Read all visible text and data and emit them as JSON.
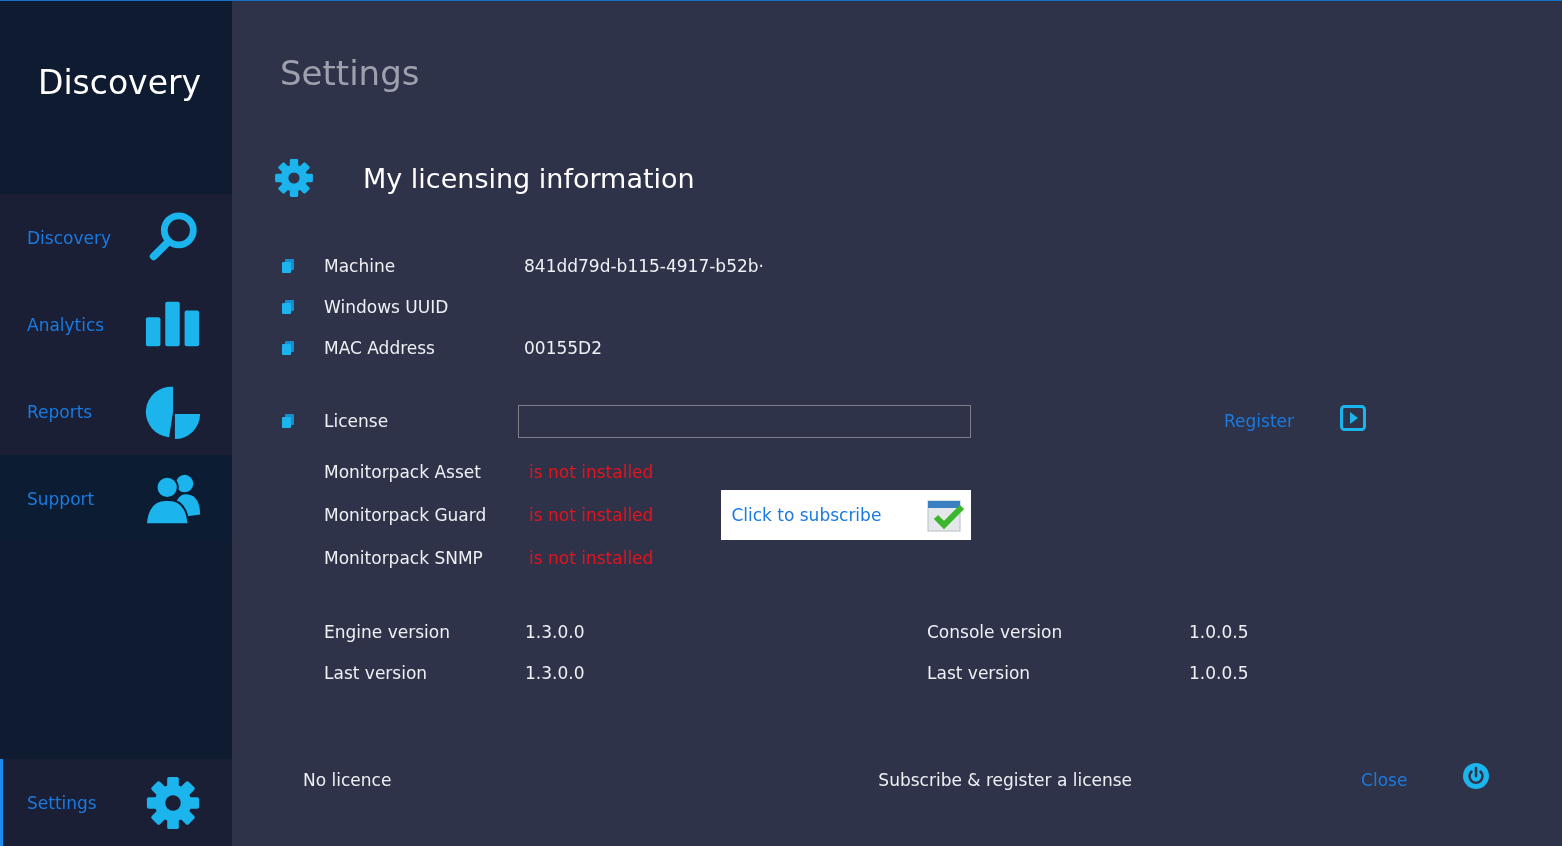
{
  "app": {
    "title": "Discovery"
  },
  "sidebar": {
    "items": [
      {
        "label": "Discovery",
        "selected": false
      },
      {
        "label": "Analytics",
        "selected": false
      },
      {
        "label": "Reports",
        "selected": false
      },
      {
        "label": "Support",
        "selected": false
      },
      {
        "label": "Settings",
        "selected": true
      }
    ]
  },
  "page": {
    "title": "Settings",
    "section_title": "My licensing information"
  },
  "info": [
    {
      "label": "Machine",
      "value": "841dd79d-b115-4917-b52b·"
    },
    {
      "label": "Windows UUID"
    },
    {
      "label": "MAC Address",
      "value": "00155D2"
    }
  ],
  "license": {
    "label": "License",
    "register": "Register"
  },
  "monitorpacks": [
    {
      "name": "Monitorpack Asset",
      "status": "is not installed",
      "installed": false
    },
    {
      "name": "Monitorpack Guard",
      "status": "is not installed",
      "installed": false
    },
    {
      "name": "Monitorpack SNMP",
      "status": "is not installed",
      "installed": false
    }
  ],
  "subscribe_button": "Click to subscribe",
  "versions": [
    {
      "label": "Engine version",
      "value": "1.3.0.0",
      "label_2": "Console version",
      "value_2": "1.0.0.5"
    },
    {
      "label": "Last version",
      "value": "1.3.0.0",
      "label_2": "Last version",
      "value_2": "1.0.0.5"
    }
  ],
  "footer": {
    "status": "No licence",
    "action": "Subscribe & register a license",
    "close": "Close"
  }
}
